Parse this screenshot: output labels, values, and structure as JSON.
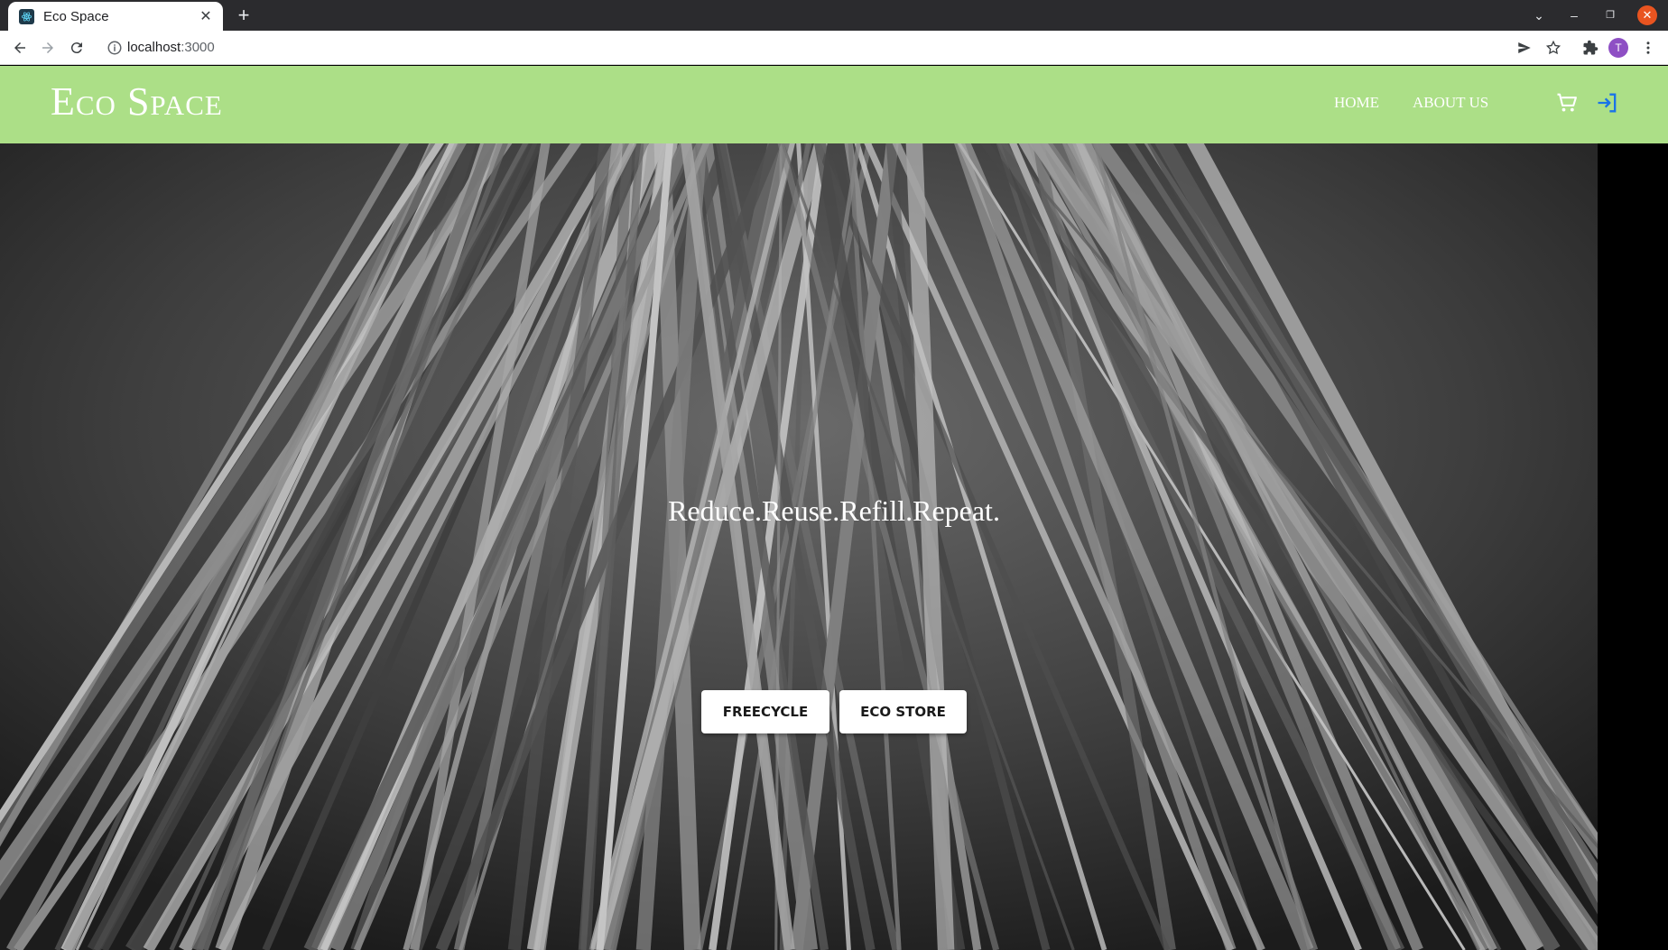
{
  "browser": {
    "tab_title": "Eco Space",
    "new_tab": "+",
    "url_host": "localhost",
    "url_port": ":3000",
    "avatar_initial": "T"
  },
  "site": {
    "brand": "Eco Space",
    "nav": {
      "home": "HOME",
      "about": "ABOUT US"
    },
    "icons": {
      "cart": "shopping-cart-icon",
      "login": "login-icon"
    },
    "hero": {
      "tagline": "Reduce.Reuse.Refill.Repeat.",
      "buttons": {
        "freecycle": "FREECYCLE",
        "eco_store": "ECO STORE"
      }
    }
  },
  "colors": {
    "navbar": "#acdf87",
    "login_icon": "#1a73e8"
  }
}
